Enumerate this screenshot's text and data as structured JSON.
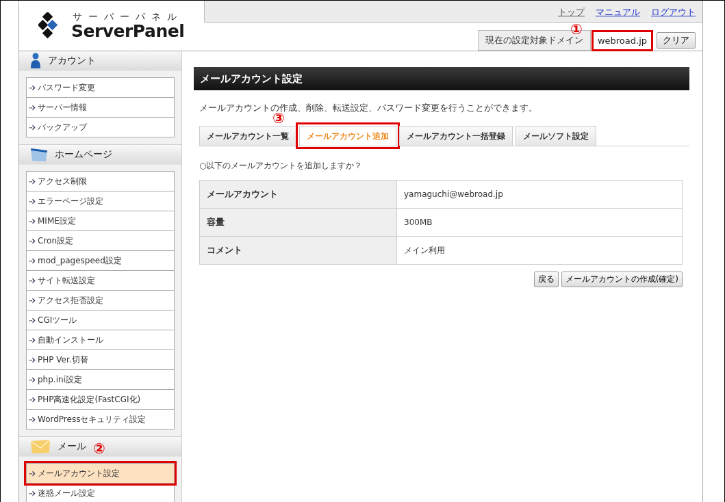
{
  "logo": {
    "kana": "サーバーパネル",
    "name": "ServerPanel"
  },
  "header_links": [
    "トップ",
    "マニュアル",
    "ログアウト"
  ],
  "domain": {
    "label": "現在の設定対象ドメイン",
    "value": "webroad.jp",
    "highlighted": true,
    "marker": "①"
  },
  "clear_button": "クリア",
  "sidebar": {
    "sections": [
      {
        "title": "アカウント",
        "kind": "person",
        "items": [
          {
            "label": "パスワード変更",
            "selected": false,
            "highlighted": false
          },
          {
            "label": "サーバー情報",
            "selected": false,
            "highlighted": false
          },
          {
            "label": "バックアップ",
            "selected": false,
            "highlighted": false
          }
        ]
      },
      {
        "title": "ホームページ",
        "kind": "window",
        "items": [
          {
            "label": "アクセス制限",
            "selected": false,
            "highlighted": false
          },
          {
            "label": "エラーページ設定",
            "selected": false,
            "highlighted": false
          },
          {
            "label": "MIME設定",
            "selected": false,
            "highlighted": false
          },
          {
            "label": "Cron設定",
            "selected": false,
            "highlighted": false
          },
          {
            "label": "mod_pagespeed設定",
            "selected": false,
            "highlighted": false
          },
          {
            "label": "サイト転送設定",
            "selected": false,
            "highlighted": false
          },
          {
            "label": "アクセス拒否設定",
            "selected": false,
            "highlighted": false
          },
          {
            "label": "CGIツール",
            "selected": false,
            "highlighted": false
          },
          {
            "label": "自動インストール",
            "selected": false,
            "highlighted": false
          },
          {
            "label": "PHP Ver.切替",
            "selected": false,
            "highlighted": false
          },
          {
            "label": "php.ini設定",
            "selected": false,
            "highlighted": false
          },
          {
            "label": "PHP高速化設定(FastCGI化)",
            "selected": false,
            "highlighted": false
          },
          {
            "label": "WordPressセキュリティ設定",
            "selected": false,
            "highlighted": false
          }
        ]
      },
      {
        "title": "メール",
        "kind": "envelope",
        "marker": "②",
        "items": [
          {
            "label": "メールアカウント設定",
            "selected": true,
            "highlighted": true
          },
          {
            "label": "迷惑メール設定",
            "selected": false,
            "highlighted": false
          }
        ]
      }
    ]
  },
  "page_title": "メールアカウント設定",
  "description": "メールアカウントの作成、削除、転送設定、パスワード変更を行うことができます。",
  "tabs": [
    {
      "label": "メールアカウント一覧",
      "selected": false,
      "highlighted": false
    },
    {
      "label": "メールアカウント追加",
      "selected": true,
      "highlighted": true,
      "marker": "③"
    },
    {
      "label": "メールアカウント一括登録",
      "selected": false,
      "highlighted": false
    },
    {
      "label": "メールソフト設定",
      "selected": false,
      "highlighted": false
    }
  ],
  "question": "○以下のメールアカウントを追加しますか？",
  "table": {
    "rows": [
      {
        "label": "メールアカウント",
        "value": "yamaguchi@webroad.jp"
      },
      {
        "label": "容量",
        "value": "300MB"
      },
      {
        "label": "コメント",
        "value": "メイン利用"
      }
    ]
  },
  "buttons": [
    "戻る",
    "メールアカウントの作成(確定)"
  ]
}
